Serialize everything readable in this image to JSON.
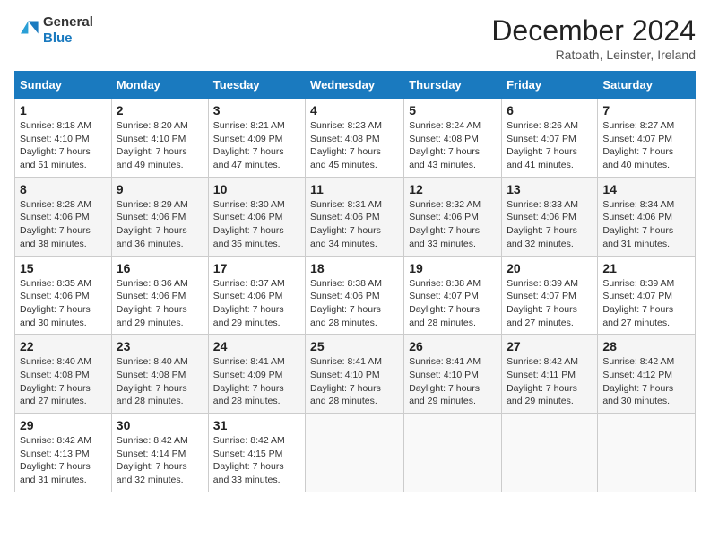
{
  "header": {
    "logo": {
      "line1": "General",
      "line2": "Blue"
    },
    "title": "December 2024",
    "subtitle": "Ratoath, Leinster, Ireland"
  },
  "calendar": {
    "days_of_week": [
      "Sunday",
      "Monday",
      "Tuesday",
      "Wednesday",
      "Thursday",
      "Friday",
      "Saturday"
    ],
    "weeks": [
      [
        {
          "day": "1",
          "sunrise": "Sunrise: 8:18 AM",
          "sunset": "Sunset: 4:10 PM",
          "daylight": "Daylight: 7 hours and 51 minutes."
        },
        {
          "day": "2",
          "sunrise": "Sunrise: 8:20 AM",
          "sunset": "Sunset: 4:10 PM",
          "daylight": "Daylight: 7 hours and 49 minutes."
        },
        {
          "day": "3",
          "sunrise": "Sunrise: 8:21 AM",
          "sunset": "Sunset: 4:09 PM",
          "daylight": "Daylight: 7 hours and 47 minutes."
        },
        {
          "day": "4",
          "sunrise": "Sunrise: 8:23 AM",
          "sunset": "Sunset: 4:08 PM",
          "daylight": "Daylight: 7 hours and 45 minutes."
        },
        {
          "day": "5",
          "sunrise": "Sunrise: 8:24 AM",
          "sunset": "Sunset: 4:08 PM",
          "daylight": "Daylight: 7 hours and 43 minutes."
        },
        {
          "day": "6",
          "sunrise": "Sunrise: 8:26 AM",
          "sunset": "Sunset: 4:07 PM",
          "daylight": "Daylight: 7 hours and 41 minutes."
        },
        {
          "day": "7",
          "sunrise": "Sunrise: 8:27 AM",
          "sunset": "Sunset: 4:07 PM",
          "daylight": "Daylight: 7 hours and 40 minutes."
        }
      ],
      [
        {
          "day": "8",
          "sunrise": "Sunrise: 8:28 AM",
          "sunset": "Sunset: 4:06 PM",
          "daylight": "Daylight: 7 hours and 38 minutes."
        },
        {
          "day": "9",
          "sunrise": "Sunrise: 8:29 AM",
          "sunset": "Sunset: 4:06 PM",
          "daylight": "Daylight: 7 hours and 36 minutes."
        },
        {
          "day": "10",
          "sunrise": "Sunrise: 8:30 AM",
          "sunset": "Sunset: 4:06 PM",
          "daylight": "Daylight: 7 hours and 35 minutes."
        },
        {
          "day": "11",
          "sunrise": "Sunrise: 8:31 AM",
          "sunset": "Sunset: 4:06 PM",
          "daylight": "Daylight: 7 hours and 34 minutes."
        },
        {
          "day": "12",
          "sunrise": "Sunrise: 8:32 AM",
          "sunset": "Sunset: 4:06 PM",
          "daylight": "Daylight: 7 hours and 33 minutes."
        },
        {
          "day": "13",
          "sunrise": "Sunrise: 8:33 AM",
          "sunset": "Sunset: 4:06 PM",
          "daylight": "Daylight: 7 hours and 32 minutes."
        },
        {
          "day": "14",
          "sunrise": "Sunrise: 8:34 AM",
          "sunset": "Sunset: 4:06 PM",
          "daylight": "Daylight: 7 hours and 31 minutes."
        }
      ],
      [
        {
          "day": "15",
          "sunrise": "Sunrise: 8:35 AM",
          "sunset": "Sunset: 4:06 PM",
          "daylight": "Daylight: 7 hours and 30 minutes."
        },
        {
          "day": "16",
          "sunrise": "Sunrise: 8:36 AM",
          "sunset": "Sunset: 4:06 PM",
          "daylight": "Daylight: 7 hours and 29 minutes."
        },
        {
          "day": "17",
          "sunrise": "Sunrise: 8:37 AM",
          "sunset": "Sunset: 4:06 PM",
          "daylight": "Daylight: 7 hours and 29 minutes."
        },
        {
          "day": "18",
          "sunrise": "Sunrise: 8:38 AM",
          "sunset": "Sunset: 4:06 PM",
          "daylight": "Daylight: 7 hours and 28 minutes."
        },
        {
          "day": "19",
          "sunrise": "Sunrise: 8:38 AM",
          "sunset": "Sunset: 4:07 PM",
          "daylight": "Daylight: 7 hours and 28 minutes."
        },
        {
          "day": "20",
          "sunrise": "Sunrise: 8:39 AM",
          "sunset": "Sunset: 4:07 PM",
          "daylight": "Daylight: 7 hours and 27 minutes."
        },
        {
          "day": "21",
          "sunrise": "Sunrise: 8:39 AM",
          "sunset": "Sunset: 4:07 PM",
          "daylight": "Daylight: 7 hours and 27 minutes."
        }
      ],
      [
        {
          "day": "22",
          "sunrise": "Sunrise: 8:40 AM",
          "sunset": "Sunset: 4:08 PM",
          "daylight": "Daylight: 7 hours and 27 minutes."
        },
        {
          "day": "23",
          "sunrise": "Sunrise: 8:40 AM",
          "sunset": "Sunset: 4:08 PM",
          "daylight": "Daylight: 7 hours and 28 minutes."
        },
        {
          "day": "24",
          "sunrise": "Sunrise: 8:41 AM",
          "sunset": "Sunset: 4:09 PM",
          "daylight": "Daylight: 7 hours and 28 minutes."
        },
        {
          "day": "25",
          "sunrise": "Sunrise: 8:41 AM",
          "sunset": "Sunset: 4:10 PM",
          "daylight": "Daylight: 7 hours and 28 minutes."
        },
        {
          "day": "26",
          "sunrise": "Sunrise: 8:41 AM",
          "sunset": "Sunset: 4:10 PM",
          "daylight": "Daylight: 7 hours and 29 minutes."
        },
        {
          "day": "27",
          "sunrise": "Sunrise: 8:42 AM",
          "sunset": "Sunset: 4:11 PM",
          "daylight": "Daylight: 7 hours and 29 minutes."
        },
        {
          "day": "28",
          "sunrise": "Sunrise: 8:42 AM",
          "sunset": "Sunset: 4:12 PM",
          "daylight": "Daylight: 7 hours and 30 minutes."
        }
      ],
      [
        {
          "day": "29",
          "sunrise": "Sunrise: 8:42 AM",
          "sunset": "Sunset: 4:13 PM",
          "daylight": "Daylight: 7 hours and 31 minutes."
        },
        {
          "day": "30",
          "sunrise": "Sunrise: 8:42 AM",
          "sunset": "Sunset: 4:14 PM",
          "daylight": "Daylight: 7 hours and 32 minutes."
        },
        {
          "day": "31",
          "sunrise": "Sunrise: 8:42 AM",
          "sunset": "Sunset: 4:15 PM",
          "daylight": "Daylight: 7 hours and 33 minutes."
        },
        null,
        null,
        null,
        null
      ]
    ]
  }
}
